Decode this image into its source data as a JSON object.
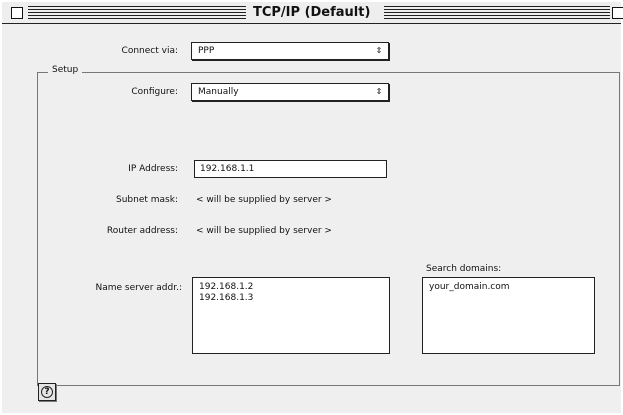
{
  "window": {
    "title": "TCP/IP (Default)"
  },
  "connect_via": {
    "label": "Connect via:",
    "value": "PPP"
  },
  "setup": {
    "group_label": "Setup",
    "configure": {
      "label": "Configure:",
      "value": "Manually"
    },
    "ip_address": {
      "label": "IP Address:",
      "value": "192.168.1.1"
    },
    "subnet_mask": {
      "label": "Subnet mask:",
      "value": "< will be supplied by server >"
    },
    "router_address": {
      "label": "Router address:",
      "value": "< will be supplied by server >"
    },
    "name_servers": {
      "label": "Name server addr.:",
      "items": [
        "192.168.1.2",
        "192.168.1.3"
      ]
    },
    "search_domains": {
      "label": "Search domains:",
      "items": [
        "your_domain.com"
      ]
    }
  },
  "icons": {
    "popup_arrow": "up-down-arrows-icon",
    "help": "help-question-icon"
  }
}
